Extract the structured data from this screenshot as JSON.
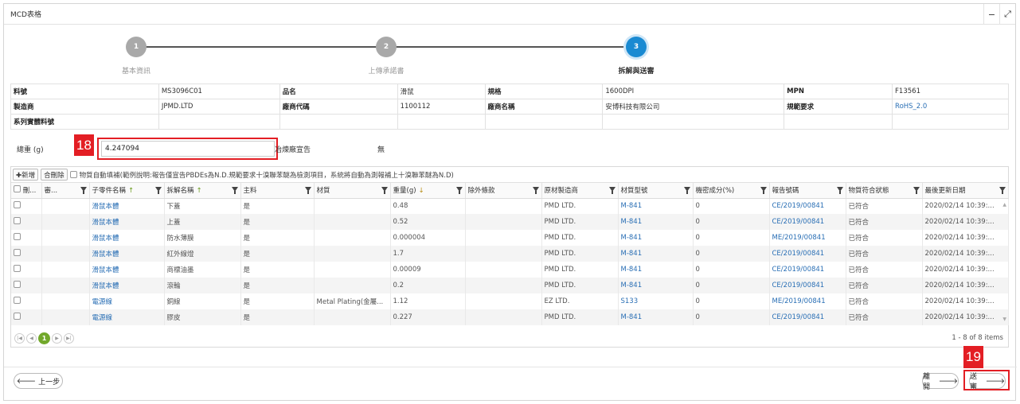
{
  "window": {
    "title": "MCD表格",
    "minimize_icon": "−",
    "expand_icon": "⤢"
  },
  "stepper": {
    "steps": [
      {
        "number": "1",
        "label": "基本資訊"
      },
      {
        "number": "2",
        "label": "上傳承諾書"
      },
      {
        "number": "3",
        "label": "拆解與送審"
      }
    ]
  },
  "info": {
    "row1": [
      "料號",
      "MS3096C01",
      "品名",
      "滑鼠",
      "規格",
      "1600DPI",
      "MPN",
      "F13561"
    ],
    "row2": [
      "製造商",
      "JPMD.LTD",
      "廠商代碼",
      "1100112",
      "廠商名稱",
      "安博科技有限公司",
      "規範要求",
      "RoHS_2.0"
    ],
    "row3_label": "系列實體料號"
  },
  "weight": {
    "label": "總重 (g)",
    "value": "4.247094",
    "brand_label": "冶煉廠宣告",
    "brand_value": "無"
  },
  "annotations": {
    "badge1": "18",
    "badge2": "19"
  },
  "toolbar": {
    "add_label": "✚新增",
    "delete_label": "合刪除",
    "note": "物質自動填補(範例說明:報告僅宣告PBDEs為N.D.規範要求十溴聯苯醚為檢測項目，系統將自動為測報補上十溴聯苯醚為N.D)"
  },
  "columns": [
    "刪...",
    "審...",
    "子零件名稱",
    "拆解名稱",
    "主料",
    "材質",
    "重量(g)",
    "除外條款",
    "原材製造商",
    "材質型號",
    "機密成分(%)",
    "報告號碼",
    "物質符合狀態",
    "最後更新日期"
  ],
  "rows": [
    [
      "",
      "",
      "滑鼠本體",
      "下蓋",
      "是",
      "",
      "0.48",
      "",
      "PMD LTD.",
      "M-841",
      "0",
      "CE/2019/00841",
      "已符合",
      "2020/02/14 10:39:..."
    ],
    [
      "",
      "",
      "滑鼠本體",
      "上蓋",
      "是",
      "",
      "0.52",
      "",
      "PMD LTD.",
      "M-841",
      "0",
      "CE/2019/00841",
      "已符合",
      "2020/02/14 10:39:..."
    ],
    [
      "",
      "",
      "滑鼠本體",
      "防水薄膜",
      "是",
      "",
      "0.000004",
      "",
      "PMD LTD.",
      "M-841",
      "0",
      "ME/2019/00841",
      "已符合",
      "2020/02/14 10:39:..."
    ],
    [
      "",
      "",
      "滑鼠本體",
      "紅外線燈",
      "是",
      "",
      "1.7",
      "",
      "PMD LTD.",
      "M-841",
      "0",
      "CE/2019/00841",
      "已符合",
      "2020/02/14 10:39:..."
    ],
    [
      "",
      "",
      "滑鼠本體",
      "商標油墨",
      "是",
      "",
      "0.00009",
      "",
      "PMD LTD.",
      "M-841",
      "0",
      "CE/2019/00841",
      "已符合",
      "2020/02/14 10:39:..."
    ],
    [
      "",
      "",
      "滑鼠本體",
      "滾輪",
      "是",
      "",
      "0.2",
      "",
      "PMD LTD.",
      "M-841",
      "0",
      "CE/2019/00841",
      "已符合",
      "2020/02/14 10:39:..."
    ],
    [
      "",
      "",
      "電源線",
      "銅線",
      "是",
      "Metal Plating(金屬...",
      "1.12",
      "",
      "EZ LTD.",
      "S133",
      "0",
      "ME/2019/00841",
      "已符合",
      "2020/02/14 10:39:..."
    ],
    [
      "",
      "",
      "電源線",
      "膠皮",
      "是",
      "",
      "0.227",
      "",
      "PMD LTD.",
      "M-841",
      "0",
      "CE/2019/00841",
      "已符合",
      "2020/02/14 10:39:..."
    ]
  ],
  "pager": {
    "current_page": "1",
    "info": "1 - 8 of 8 items"
  },
  "footer": {
    "back_label": "上一步",
    "leave_label": "離開",
    "submit_label": "送審"
  },
  "colors": {
    "accent": "#1a8ad2",
    "highlight": "#e31e24",
    "link": "#2a6fb5",
    "pager_active": "#72a82b"
  }
}
